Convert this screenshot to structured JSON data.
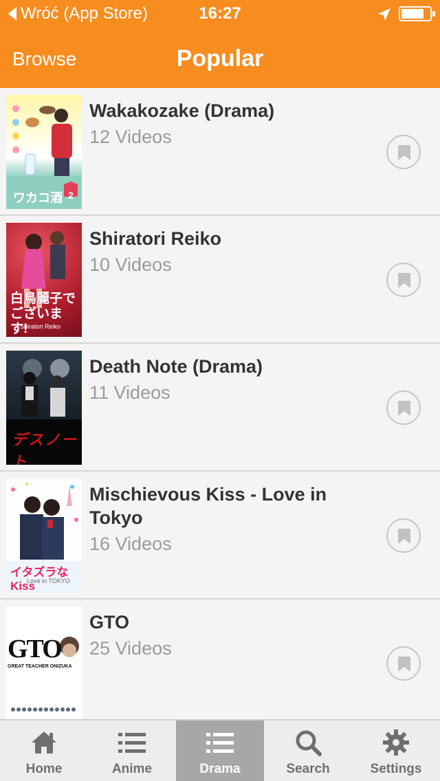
{
  "colors": {
    "accent": "#f78d1f"
  },
  "status": {
    "back_label": "Wróć (App Store)",
    "time": "16:27"
  },
  "nav": {
    "left_label": "Browse",
    "title": "Popular"
  },
  "items": [
    {
      "title": "Wakakozake (Drama)",
      "count": "12 Videos",
      "poster_text": "ワカコ酒",
      "poster_badge": "2"
    },
    {
      "title": "Shiratori Reiko",
      "count": "10 Videos",
      "poster_text": "白鳥麗子でございます!",
      "poster_sub": "Shiratori Reiko"
    },
    {
      "title": "Death Note (Drama)",
      "count": "11 Videos",
      "poster_text": "デスノート"
    },
    {
      "title": "Mischievous Kiss - Love in Tokyo",
      "count": "16 Videos",
      "poster_text": "イタズラなKiss",
      "poster_sub": "Love in TOKYO"
    },
    {
      "title": "GTO",
      "count": "25 Videos",
      "poster_text": "GTO",
      "poster_sub": "GREAT TEACHER ONIZUKA"
    }
  ],
  "tabs": [
    {
      "label": "Home",
      "icon": "home-icon"
    },
    {
      "label": "Anime",
      "icon": "list-icon"
    },
    {
      "label": "Drama",
      "icon": "list-icon",
      "active": true
    },
    {
      "label": "Search",
      "icon": "search-icon"
    },
    {
      "label": "Settings",
      "icon": "gear-icon"
    }
  ]
}
